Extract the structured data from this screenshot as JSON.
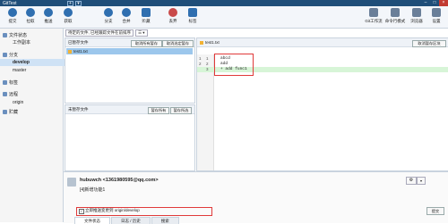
{
  "window": {
    "title": "GitTest",
    "add_tab": "+",
    "tab_menu": "▾",
    "minimize": "–",
    "maximize": "□",
    "close": "×"
  },
  "toolbar": {
    "left": [
      "提交",
      "拉取",
      "推送",
      "获取",
      "分支",
      "合并",
      "贮藏",
      "丢弃",
      "标签"
    ],
    "right": [
      "Git工作流",
      "命令行模式",
      "浏览器",
      "设置"
    ]
  },
  "sidebar": {
    "workspace": "文件状态",
    "workspace_sub": "工作副本",
    "branches": "分支",
    "branch_develop": "develop",
    "branch_master": "master",
    "tags": "标签",
    "remotes": "远程",
    "remote_origin": "origin",
    "stashes": "贮藏"
  },
  "main": {
    "filter_dropdown": "待定的文件, 已经跟踪文件在前排序",
    "staged_header": "已暂存文件",
    "btn_unstage_all": "取消所有暂存",
    "btn_unstage_selected": "取消选定暂存",
    "staged_file": "test1.txt",
    "unstaged_header": "未暂存文件",
    "btn_stage_all": "暂存所有",
    "btn_stage_selected": "暂存所选",
    "diff_file": "test1.txt",
    "btn_unstage_block": "取消暂存区块",
    "diff_lines": [
      {
        "n1": "1",
        "n2": "1",
        "code": "  abcd",
        "add": false
      },
      {
        "n1": "2",
        "n2": "2",
        "code": "  add",
        "add": false
      },
      {
        "n1": "",
        "n2": "3",
        "code": "+ add func1",
        "add": true
      }
    ]
  },
  "commit": {
    "author": "hubuwch <1361980595@qq.com>",
    "message": "[4]新增功能1",
    "push_checkbox_label": "立即推送变更到 origin/develop",
    "submit_button": "提交",
    "tab_file_status": "文件状态",
    "tab_log": "日志 / 历史",
    "tab_search": "搜索"
  }
}
